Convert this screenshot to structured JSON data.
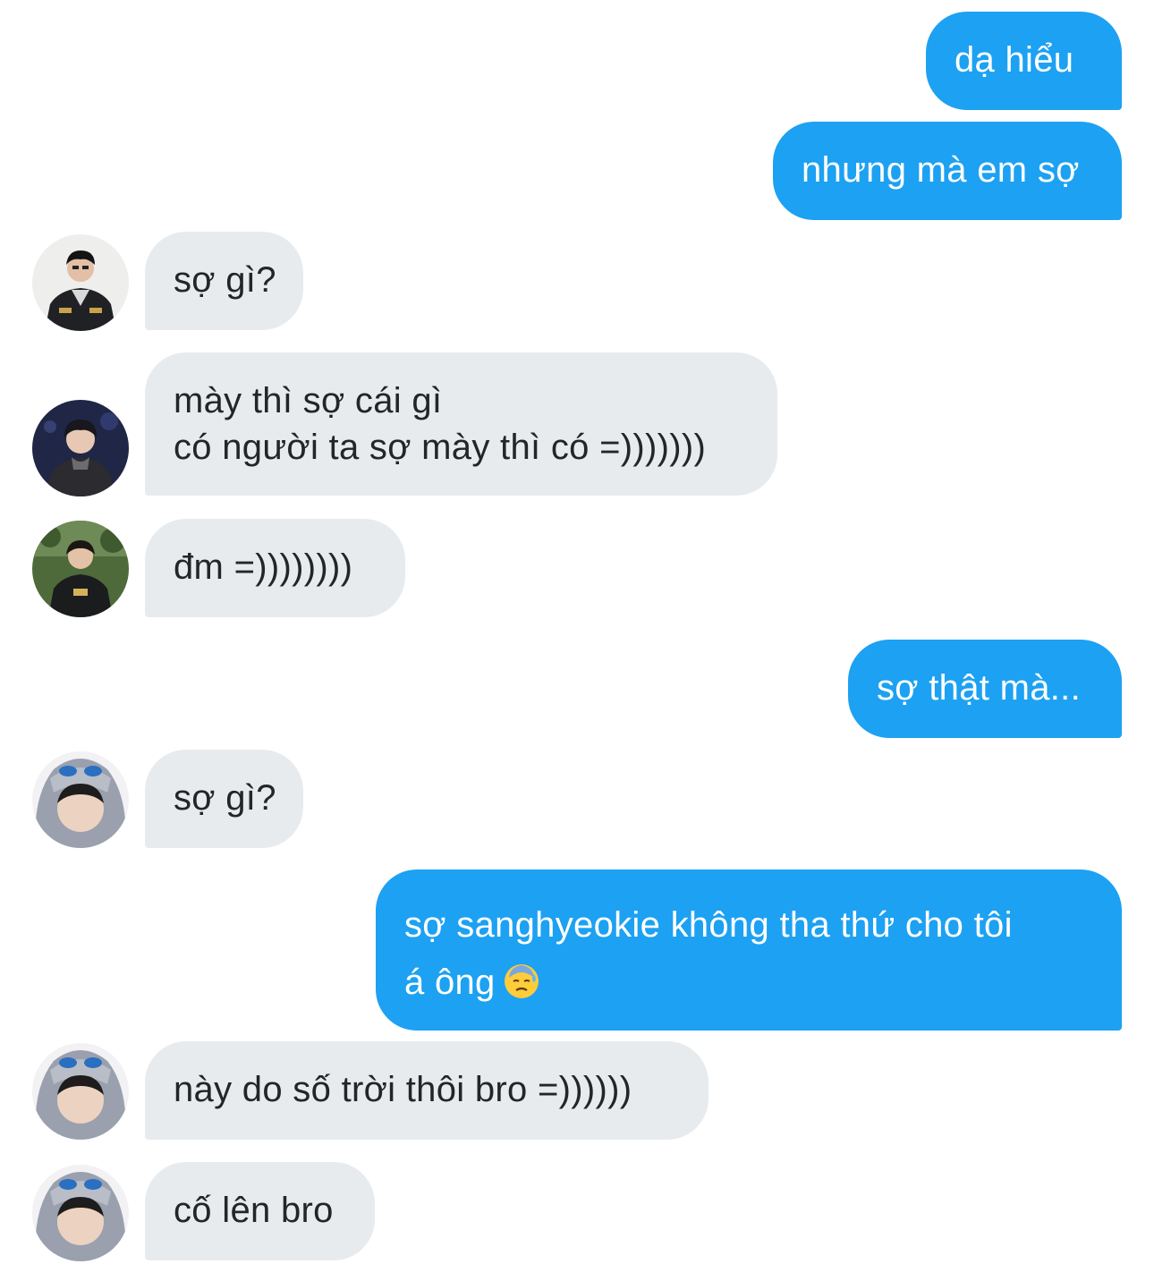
{
  "messages": [
    {
      "direction": "outgoing",
      "text": "dạ hiểu"
    },
    {
      "direction": "outgoing",
      "text": "nhưng mà em sợ"
    },
    {
      "direction": "incoming",
      "avatar": "avatar-player-1",
      "text": "sợ gì?"
    },
    {
      "direction": "incoming",
      "avatar": "avatar-player-2",
      "lines": [
        "mày thì sợ cái gì",
        "có người ta sợ mày thì có =)))))))"
      ]
    },
    {
      "direction": "incoming",
      "avatar": "avatar-player-3",
      "text": "đm =))))))))"
    },
    {
      "direction": "outgoing",
      "text": "sợ thật mà..."
    },
    {
      "direction": "incoming",
      "avatar": "avatar-player-4",
      "text": "sợ gì?"
    },
    {
      "direction": "outgoing",
      "lines": [
        "sợ sanghyeokie không tha thứ cho tôi",
        "á ông"
      ],
      "emoji": "downcast-face-with-sweat-emoji"
    },
    {
      "direction": "incoming",
      "avatar": "avatar-player-4",
      "text": "này do số trời thôi bro =))))))"
    },
    {
      "direction": "incoming",
      "avatar": "avatar-player-4",
      "text": "cố lên bro"
    }
  ],
  "colors": {
    "outgoing_bubble": "#1da1f2",
    "incoming_bubble": "#e8ebee",
    "incoming_text": "#222628",
    "outgoing_text": "#ffffff"
  }
}
